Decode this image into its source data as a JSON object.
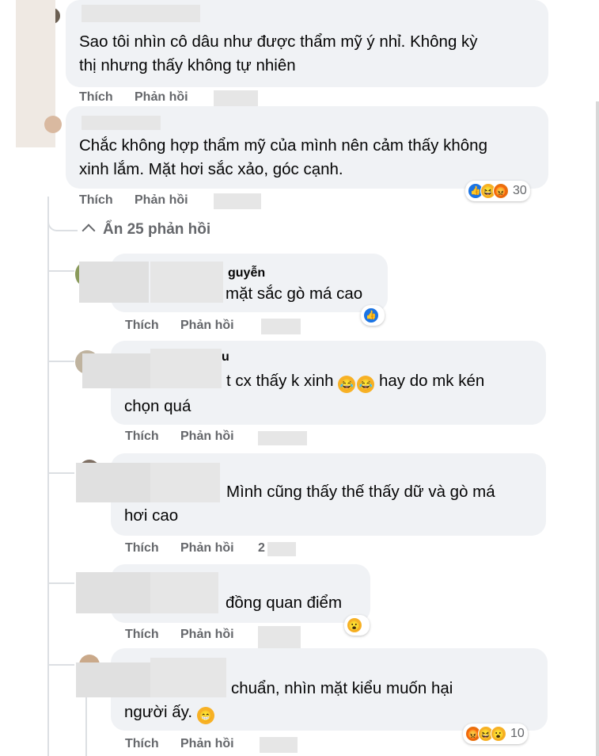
{
  "comments": [
    {
      "text_lines": [
        "Sao tôi nhìn cô dâu như được thẩm mỹ ý nhỉ. Không kỳ",
        "thị nhưng thấy không tự nhiên"
      ],
      "like_label": "Thích",
      "reply_label": "Phản hồi"
    },
    {
      "text_lines": [
        "Chắc không hợp thẩm mỹ của mình nên cảm thấy không",
        "xinh lắm. Mặt hơi sắc xảo, góc cạnh."
      ],
      "like_label": "Thích",
      "reply_label": "Phản hồi",
      "reactions": {
        "icons": [
          "like-icon",
          "haha-icon",
          "angry-icon"
        ],
        "count": "30"
      }
    }
  ],
  "replies_toggle": {
    "chevron": "^",
    "label": "Ẩn 25 phản hồi"
  },
  "replies": [
    {
      "author_partial": "guyễn",
      "text_lines": [
        "mặt sắc gò má cao"
      ],
      "like_label": "Thích",
      "reply_label": "Phản hồi",
      "reactions": {
        "icons": [
          "like-icon"
        ]
      }
    },
    {
      "author_partial": "u",
      "text_lines": [
        "t cx thấy k xinh 😂😂 hay do mk kén",
        "chọn quá"
      ],
      "like_label": "Thích",
      "reply_label": "Phản hồi"
    },
    {
      "text_lines": [
        "Mình cũng thấy thế thấy dữ và gò má",
        "hơi cao"
      ],
      "like_label": "Thích",
      "reply_label": "Phản hồi",
      "time_partial": "2"
    },
    {
      "text_lines": [
        "đồng quan điểm"
      ],
      "like_label": "Thích",
      "reply_label": "Phản hồi",
      "reactions": {
        "icons": [
          "wow-icon"
        ]
      }
    },
    {
      "text_lines": [
        "chuẩn, nhìn mặt kiểu muốn hại",
        "người ấy. 😁"
      ],
      "like_label": "Thích",
      "reply_label": "Phản hồi",
      "reactions": {
        "icons": [
          "angry-icon",
          "haha-icon",
          "wow-icon"
        ],
        "count": "10"
      }
    }
  ],
  "colors": {
    "bubble": "#f0f2f5",
    "action_text": "#65676b",
    "like_blue": "#1b74e4",
    "haha_yellow": "#f7b125",
    "angry_orange": "#e9710f"
  }
}
